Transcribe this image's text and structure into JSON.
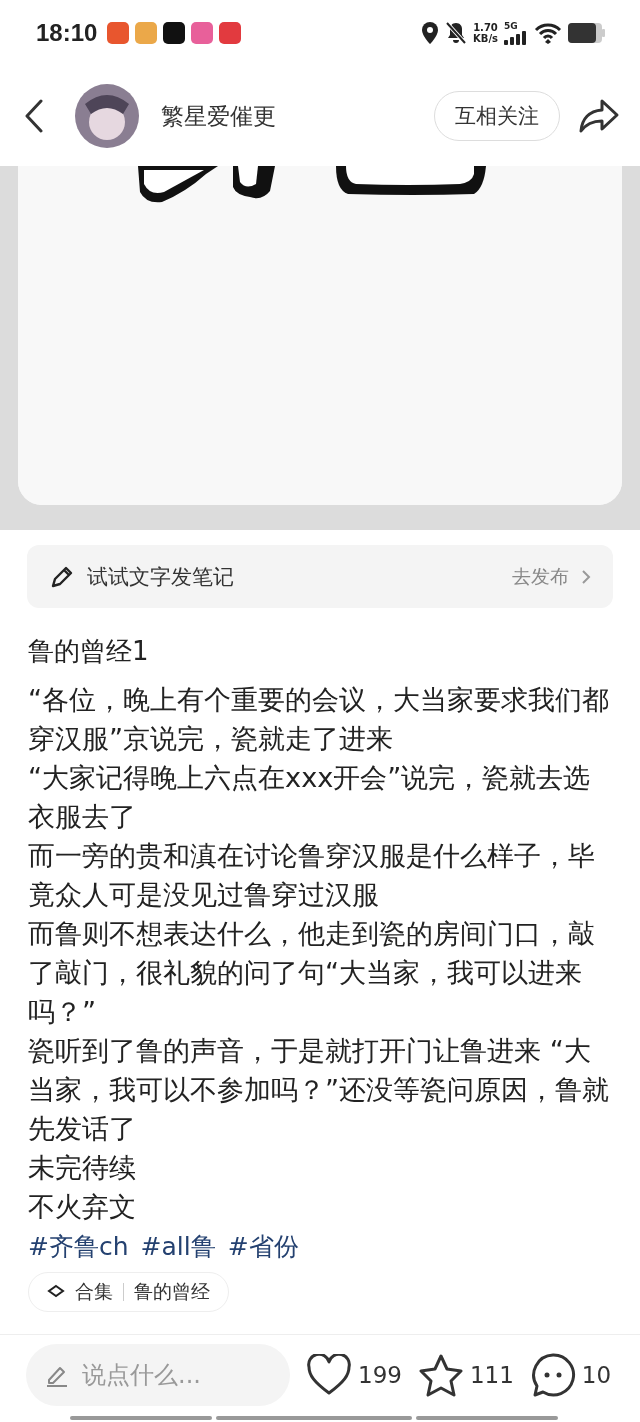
{
  "status_bar": {
    "time": "18:10",
    "net_speed": "1.70",
    "net_unit": "KB/s",
    "network": "5G"
  },
  "header": {
    "author": "繁星爱催更",
    "follow_button": "互相关注"
  },
  "note_prompt": {
    "text": "试试文字发笔记",
    "action": "去发布"
  },
  "post": {
    "title": "鲁的曾经1",
    "paragraphs": [
      "“各位，晚上有个重要的会议，大当家要求我们都穿汉服”京说完，瓷就走了进来",
      "“大家记得晚上六点在xxx开会”说完，瓷就去选衣服去了",
      "而一旁的贵和滇在讨论鲁穿汉服是什么样子，毕竟众人可是没见过鲁穿过汉服",
      "而鲁则不想表达什么，他走到瓷的房间门口，敲了敲门，很礼貌的问了句“大当家，我可以进来吗？”",
      "瓷听到了鲁的声音，于是就打开门让鲁进来 “大当家，我可以不参加吗？”还没等瓷问原因，鲁就先发话了",
      "未完待续",
      "不火弃文"
    ],
    "tags": [
      "#齐鲁ch",
      "#all鲁",
      "#省份"
    ],
    "collection": {
      "label": "合集",
      "name": "鲁的曾经"
    }
  },
  "bottom_bar": {
    "comment_placeholder": "说点什么...",
    "likes": "199",
    "favorites": "111",
    "comments": "10"
  }
}
